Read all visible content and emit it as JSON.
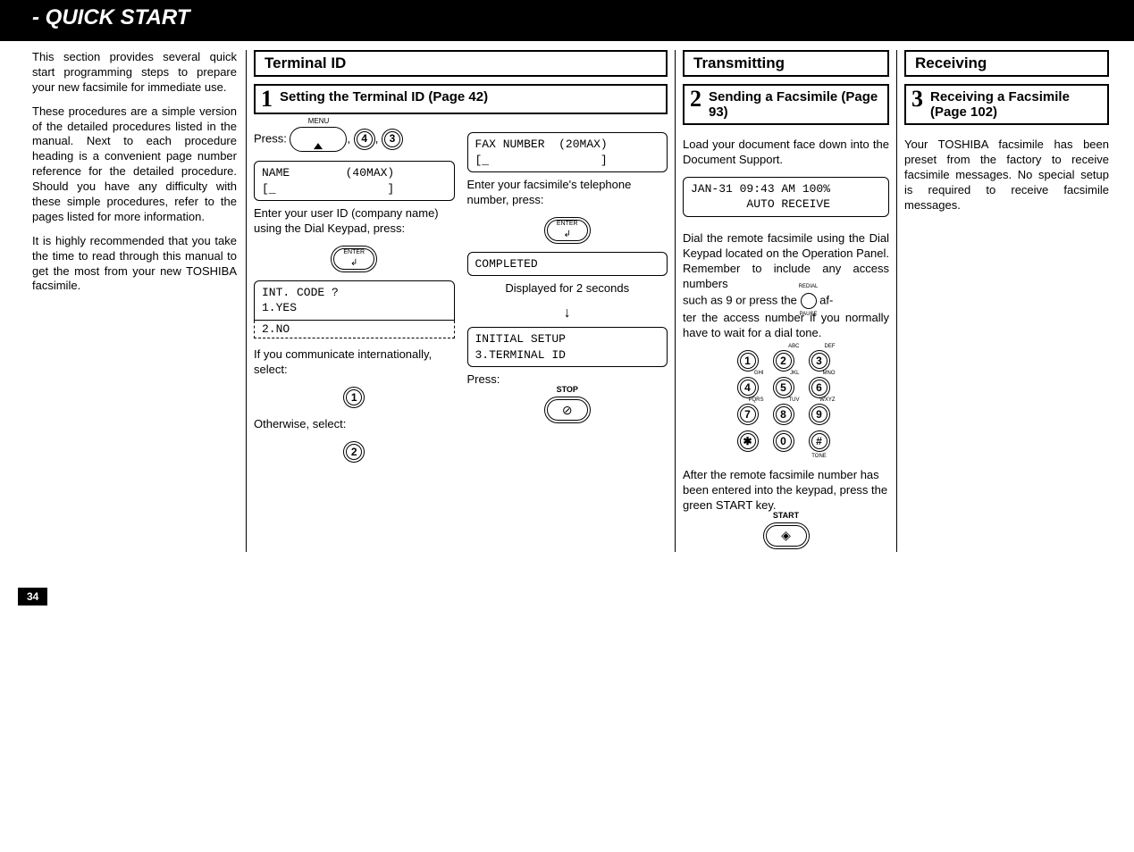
{
  "title": "- QUICK START",
  "page_number": "34",
  "intro": {
    "p1": "This section provides several quick start programming steps to prepare your new facsimile for immediate use.",
    "p2": "These procedures are a simple version of the detailed procedures listed in the manual. Next to each procedure heading is a convenient page number reference for the detailed procedure. Should you have any difficulty with these simple procedures, refer to the pages listed for more information.",
    "p3": "It is highly recommended that you take the time to read through this manual to get the most from your new TOSHIBA facsimile."
  },
  "terminal": {
    "header": "Terminal ID",
    "step_num": "1",
    "step_title": "Setting the Terminal ID (Page 42)",
    "press_label": "Press:",
    "menu_label": "MENU",
    "key4": "4",
    "key3": "3",
    "lcd_name": "NAME        (40MAX)\n[_                ]",
    "enter_id_text": "Enter your user ID (company name) using the Dial Keypad, press:",
    "enter_label": "ENTER",
    "enter_arrow": "↲",
    "lcd_intcode": "INT. CODE ?\n1.YES",
    "int_no": " 2.NO",
    "intl_text": "If you communicate internationally, select:",
    "key1": "1",
    "otherwise_text": "Otherwise, select:",
    "key2": "2",
    "lcd_fax": "FAX NUMBER  (20MAX)\n[_                ]",
    "enter_fax_text": "Enter your facsimile's telephone number, press:",
    "lcd_completed": "COMPLETED",
    "displayed_text": "Displayed for 2 seconds",
    "lcd_initial": "INITIAL SETUP\n3.TERMINAL ID",
    "press2_label": "Press:",
    "stop_label": "STOP",
    "stop_symbol": "⊘"
  },
  "transmitting": {
    "header": "Transmitting",
    "step_num": "2",
    "step_title": "Sending a Facsimile (Page 93)",
    "load_text": "Load your document face down into the Document Support.",
    "lcd_status": "JAN-31 09:43 AM 100%\n        AUTO RECEIVE",
    "dial_text1": "Dial the remote facsimile using the Dial Keypad located on the Operation Panel. Remember to include any access numbers",
    "dial_text2a": "such as 9 or press the ",
    "dial_text2b": " af-",
    "dial_text3": "ter the access number if you normally have to wait for a dial tone.",
    "redial_top": "REDIAL",
    "redial_bot": "PAUSE",
    "keypad": {
      "k1": "1",
      "k2": "2",
      "k3": "3",
      "k4": "4",
      "k5": "5",
      "k6": "6",
      "k7": "7",
      "k8": "8",
      "k9": "9",
      "ks": "✱",
      "k0": "0",
      "kh": "#",
      "s2": "ABC",
      "s3": "DEF",
      "s4": "GHI",
      "s5": "JKL",
      "s6": "MNO",
      "s7": "PQRS",
      "s8": "TUV",
      "s9": "WXYZ",
      "sh": "TONE"
    },
    "after_text": "After the remote facsimile number has been entered into the keypad, press the green START key.",
    "start_label": "START",
    "start_symbol": "◈"
  },
  "receiving": {
    "header": "Receiving",
    "step_num": "3",
    "step_title": "Receiving a Facsimile (Page 102)",
    "body": "Your TOSHIBA facsimile has been preset from the factory to receive facsimile messages. No special setup is required to receive facsimile messages."
  }
}
